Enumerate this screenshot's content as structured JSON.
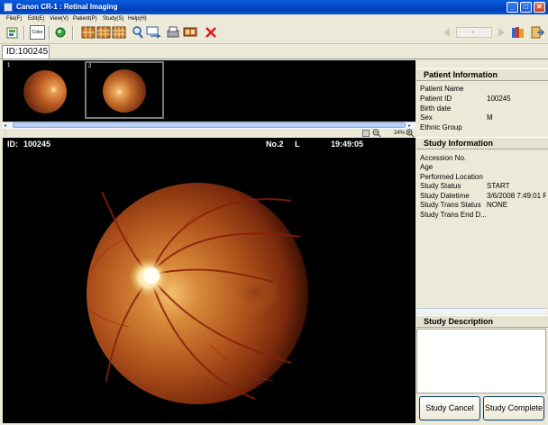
{
  "window": {
    "title": "Canon CR-1 : Retinal Imaging",
    "minimize": "_",
    "maximize": "□",
    "close": "✕"
  },
  "menu": [
    "File(F)",
    "Edit(E)",
    "View(V)",
    "Patient(P)",
    "Study(S)",
    "Help(H)"
  ],
  "toolbar": {
    "color_label": "Color"
  },
  "tab": {
    "label": "ID:100245"
  },
  "thumbnails": [
    {
      "number": "1"
    },
    {
      "number": "2"
    }
  ],
  "zoom": {
    "value": "24%"
  },
  "viewer": {
    "id_label": "ID:",
    "id_value": "100245",
    "image_no": "No.2",
    "eye": "L",
    "time": "19:49:05"
  },
  "patient_info": {
    "heading": "Patient Information",
    "fields": [
      {
        "label": "Patient Name",
        "value": ""
      },
      {
        "label": "Patient ID",
        "value": "100245"
      },
      {
        "label": "Birth date",
        "value": ""
      },
      {
        "label": "Sex",
        "value": "M"
      },
      {
        "label": "Ethnic Group",
        "value": ""
      }
    ]
  },
  "study_info": {
    "heading": "Study Information",
    "fields": [
      {
        "label": "Accession No.",
        "value": ""
      },
      {
        "label": "Age",
        "value": ""
      },
      {
        "label": "Performed Location",
        "value": ""
      },
      {
        "label": "Study Status",
        "value": "START"
      },
      {
        "label": "Study Datetime",
        "value": "3/6/2008 7:49:01 P"
      },
      {
        "label": "Study Trans Status",
        "value": "NONE"
      },
      {
        "label": "Study Trans End D...",
        "value": ""
      }
    ]
  },
  "study_description": {
    "heading": "Study Description",
    "text": ""
  },
  "buttons": {
    "cancel": "Study Cancel",
    "complete": "Study Complete"
  }
}
